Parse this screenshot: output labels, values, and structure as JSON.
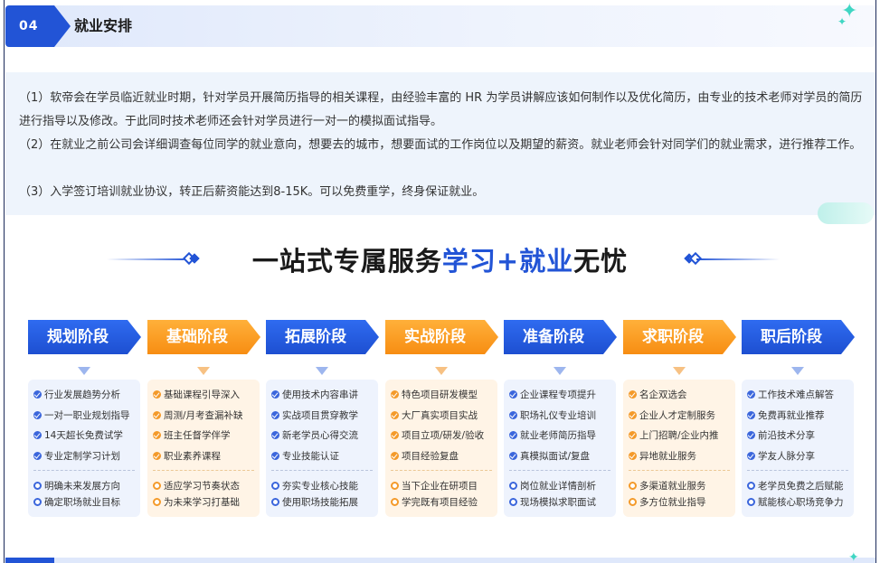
{
  "header": {
    "number": "04",
    "title": "就业安排"
  },
  "paragraphs": [
    "（1）软帝会在学员临近就业时期，针对学员开展简历指导的相关课程，由经验丰富的 HR 为学员讲解应该如何制作以及优化简历，由专业的技术老师对学员的简历进行指导以及修改。于此同时技术老师还会针对学员进行一对一的模拟面试指导。",
    "（2）在就业之前公司会详细调查每位同学的就业意向，想要去的城市，想要面试的工作岗位以及期望的薪资。就业老师会针对同学们的就业需求，进行推荐工作。",
    "（3）入学签订培训就业协议，转正后薪资能达到8-15K。可以免费重学，终身保证就业。"
  ],
  "banner": {
    "part1": "一站式专属服务",
    "part2": "学习",
    "part3": "+",
    "part4": "就业",
    "part5": "无忧"
  },
  "colors": {
    "blue": "#2254d6",
    "orange": "#f78d12",
    "teal": "#3fd6c3"
  },
  "stages": [
    {
      "label": "规划阶段",
      "color": "blue",
      "items": [
        "行业发展趋势分析",
        "一对一职业规划指导",
        "14天超长免费试学",
        "专业定制学习计划"
      ],
      "outcomes": [
        "明确未来发展方向",
        "确定职场就业目标"
      ]
    },
    {
      "label": "基础阶段",
      "color": "orange",
      "items": [
        "基础课程引导深入",
        "周测/月考查漏补缺",
        "班主任督学伴学",
        "职业素养课程"
      ],
      "outcomes": [
        "适应学习节奏状态",
        "为未来学习打基础"
      ]
    },
    {
      "label": "拓展阶段",
      "color": "blue",
      "items": [
        "使用技术内容串讲",
        "实战项目贯穿教学",
        "新老学员心得交流",
        "专业技能认证"
      ],
      "outcomes": [
        "夯实专业核心技能",
        "使用职场技能拓展"
      ]
    },
    {
      "label": "实战阶段",
      "color": "orange",
      "items": [
        "特色项目研发模型",
        "大厂真实项目实战",
        "项目立项/研发/验收",
        "项目经验复盘"
      ],
      "outcomes": [
        "当下企业在研项目",
        "学完既有项目经验"
      ]
    },
    {
      "label": "准备阶段",
      "color": "blue",
      "items": [
        "企业课程专项提升",
        "职场礼仪专业培训",
        "就业老师简历指导",
        "真模拟面试/复盘"
      ],
      "outcomes": [
        "岗位就业详情剖析",
        "现场模拟求职面试"
      ]
    },
    {
      "label": "求职阶段",
      "color": "orange",
      "items": [
        "名企双选会",
        "企业人才定制服务",
        "上门招聘/企业内推",
        "异地就业服务"
      ],
      "outcomes": [
        "多渠道就业服务",
        "多方位就业指导"
      ]
    },
    {
      "label": "职后阶段",
      "color": "blue",
      "items": [
        "工作技术难点解答",
        "免费再就业推荐",
        "前沿技术分享",
        "学友人脉分享"
      ],
      "outcomes": [
        "老学员免费之后赋能",
        "赋能核心职场竞争力"
      ]
    }
  ]
}
